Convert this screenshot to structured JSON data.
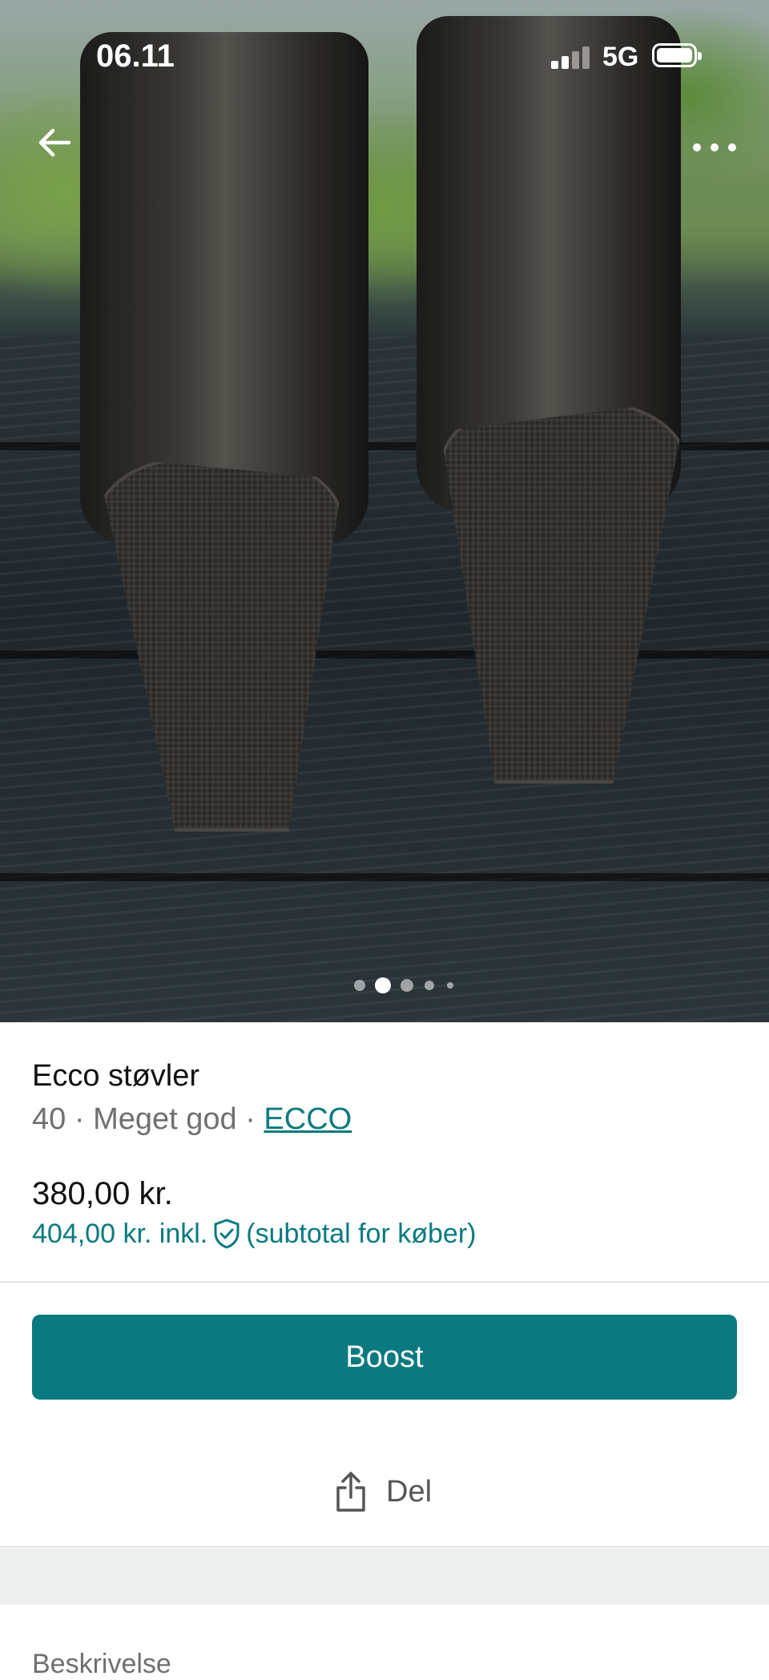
{
  "status_bar": {
    "time": "06.11",
    "network": "5G",
    "battery_level": 1.0
  },
  "nav": {
    "back_icon": "arrow-left-icon",
    "more_icon": "more-horizontal-icon"
  },
  "gallery": {
    "photo_count": 5,
    "current_index": 2
  },
  "item": {
    "title": "Ecco støvler",
    "size": "40",
    "separator": " · ",
    "condition": "Meget god",
    "brand": "ECCO",
    "price": "380,00 kr.",
    "price_incl": "404,00 kr. inkl.",
    "price_incl_note": "(subtotal for køber)",
    "protection_icon": "shield-check-icon"
  },
  "actions": {
    "boost_label": "Boost",
    "share_label": "Del",
    "share_icon": "share-icon"
  },
  "description": {
    "heading": "Beskrivelse"
  },
  "colors": {
    "accent": "#0b7a80",
    "link": "#0a7a80",
    "muted": "#6f6f6f"
  }
}
